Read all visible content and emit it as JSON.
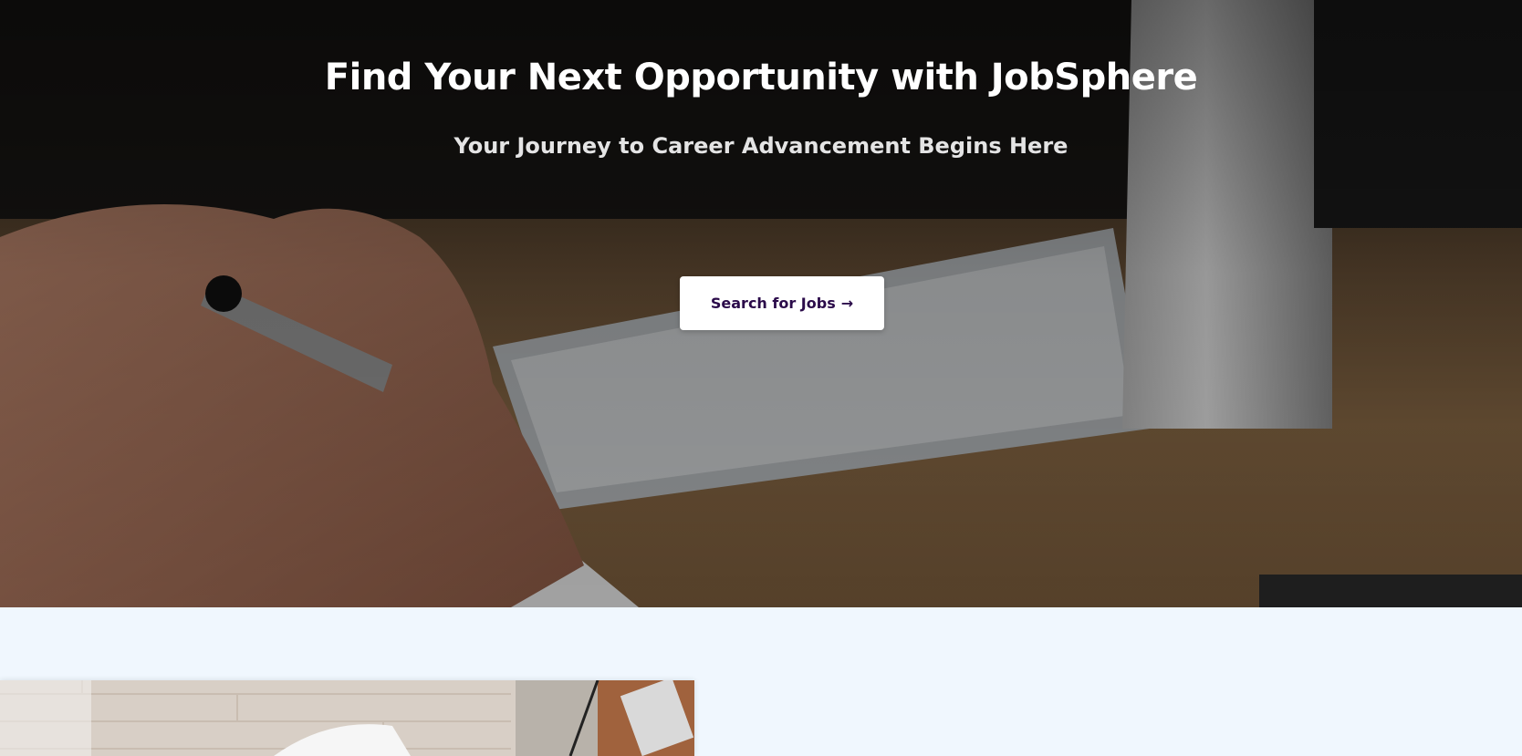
{
  "hero": {
    "title": "Find Your Next Opportunity with JobSphere",
    "subtitle": "Your Journey to Career Advancement Begins Here",
    "cta_label": "Search for Jobs",
    "cta_arrow": "→",
    "background_image": "hand-on-mouse-at-desk-photo"
  },
  "feature_section": {
    "image": "desk-top-view-photo"
  },
  "colors": {
    "cta_text": "#2b0b4a",
    "cta_background": "#ffffff",
    "section_background": "#f0f7fe"
  }
}
